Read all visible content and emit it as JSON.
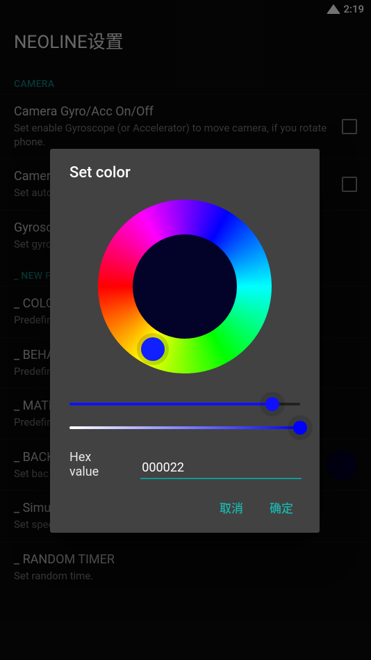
{
  "status": {
    "time": "2:19"
  },
  "app_title": "NEOLINE设置",
  "sections": {
    "camera_header": "CAMERA",
    "new_header": "_ NEW F"
  },
  "prefs": {
    "gyro": {
      "title": "Camera Gyro/Acc On/Off",
      "summary": "Set enable Gyroscope (or Accelerator) to move camera, if you rotate phone."
    },
    "autorot": {
      "title": "Camera",
      "summary": "Set auto"
    },
    "gyrospeed": {
      "title": "Gyrosc",
      "summary": "Set gyro"
    },
    "color": {
      "title": "_ COLO",
      "summary": "Predefin"
    },
    "beha": {
      "title": "_ BEHA",
      "summary": "Predefin"
    },
    "mate": {
      "title": "_ MATE",
      "summary": "Predefin"
    },
    "back": {
      "title": "_ BACK",
      "summary": "Set bac"
    },
    "simspeed": {
      "title": "_ Simulation speed",
      "summary": "Set speed of simulation."
    },
    "rtimer": {
      "title": "_ RANDOM TIMER",
      "summary": "Set random time."
    }
  },
  "dialog": {
    "title": "Set color",
    "hex_label": "Hex value",
    "hex_value": "000022",
    "cancel": "取消",
    "ok": "确定",
    "preview_color": "#03032a"
  }
}
